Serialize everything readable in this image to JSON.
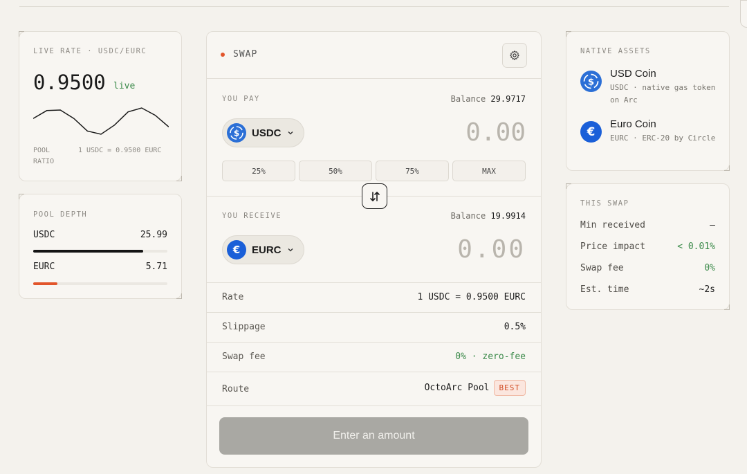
{
  "live_rate": {
    "label": "LIVE RATE · USDC/EURC",
    "value": "0.9500",
    "status": "live",
    "pool_label": "POOL RATIO",
    "pool_value": "1 USDC = 0.9500 EURC",
    "sparkline_points": [
      0.6,
      0.9,
      0.92,
      0.6,
      0.12,
      0.0,
      0.35,
      0.85,
      1.0,
      0.72,
      0.28
    ]
  },
  "pool_depth": {
    "label": "POOL DEPTH",
    "rows": [
      {
        "token": "USDC",
        "value": "25.99",
        "fill_fraction": 0.82,
        "color": "#141414"
      },
      {
        "token": "EURC",
        "value": "5.71",
        "fill_fraction": 0.18,
        "color": "#e2552b"
      }
    ]
  },
  "swap": {
    "title": "SWAP",
    "settings_icon": "gear-icon",
    "pay": {
      "label": "YOU PAY",
      "balance_label": "Balance",
      "balance_value": "29.9717",
      "token": "USDC",
      "amount_placeholder": "0.00"
    },
    "percent_buttons": [
      "25%",
      "50%",
      "75%",
      "MAX"
    ],
    "receive": {
      "label": "YOU RECEIVE",
      "balance_label": "Balance",
      "balance_value": "19.9914",
      "token": "EURC",
      "amount": "0.00"
    },
    "details": [
      {
        "key": "Rate",
        "value": "1 USDC = 0.9500 EURC"
      },
      {
        "key": "Slippage",
        "value": "0.5%"
      },
      {
        "key": "Swap fee",
        "value": "0% · zero-fee"
      },
      {
        "key": "Route",
        "value": "OctoArc Pool",
        "badge": "BEST"
      }
    ],
    "submit_label": "Enter an amount"
  },
  "native_assets": {
    "label": "NATIVE ASSETS",
    "items": [
      {
        "name": "USD Coin",
        "desc": "USDC · native gas token on Arc",
        "icon": "usdc-icon"
      },
      {
        "name": "Euro Coin",
        "desc": "EURC · ERC-20 by Circle",
        "icon": "eurc-icon"
      }
    ]
  },
  "this_swap": {
    "label": "THIS SWAP",
    "rows": [
      {
        "key": "Min received",
        "value": "—"
      },
      {
        "key": "Price impact",
        "value": "< 0.01%"
      },
      {
        "key": "Swap fee",
        "value": "0%"
      },
      {
        "key": "Est. time",
        "value": "~2s"
      }
    ]
  },
  "colors": {
    "accent": "#e2552b",
    "positive": "#3b8a4a",
    "token_blue": "#2b6fd6"
  }
}
